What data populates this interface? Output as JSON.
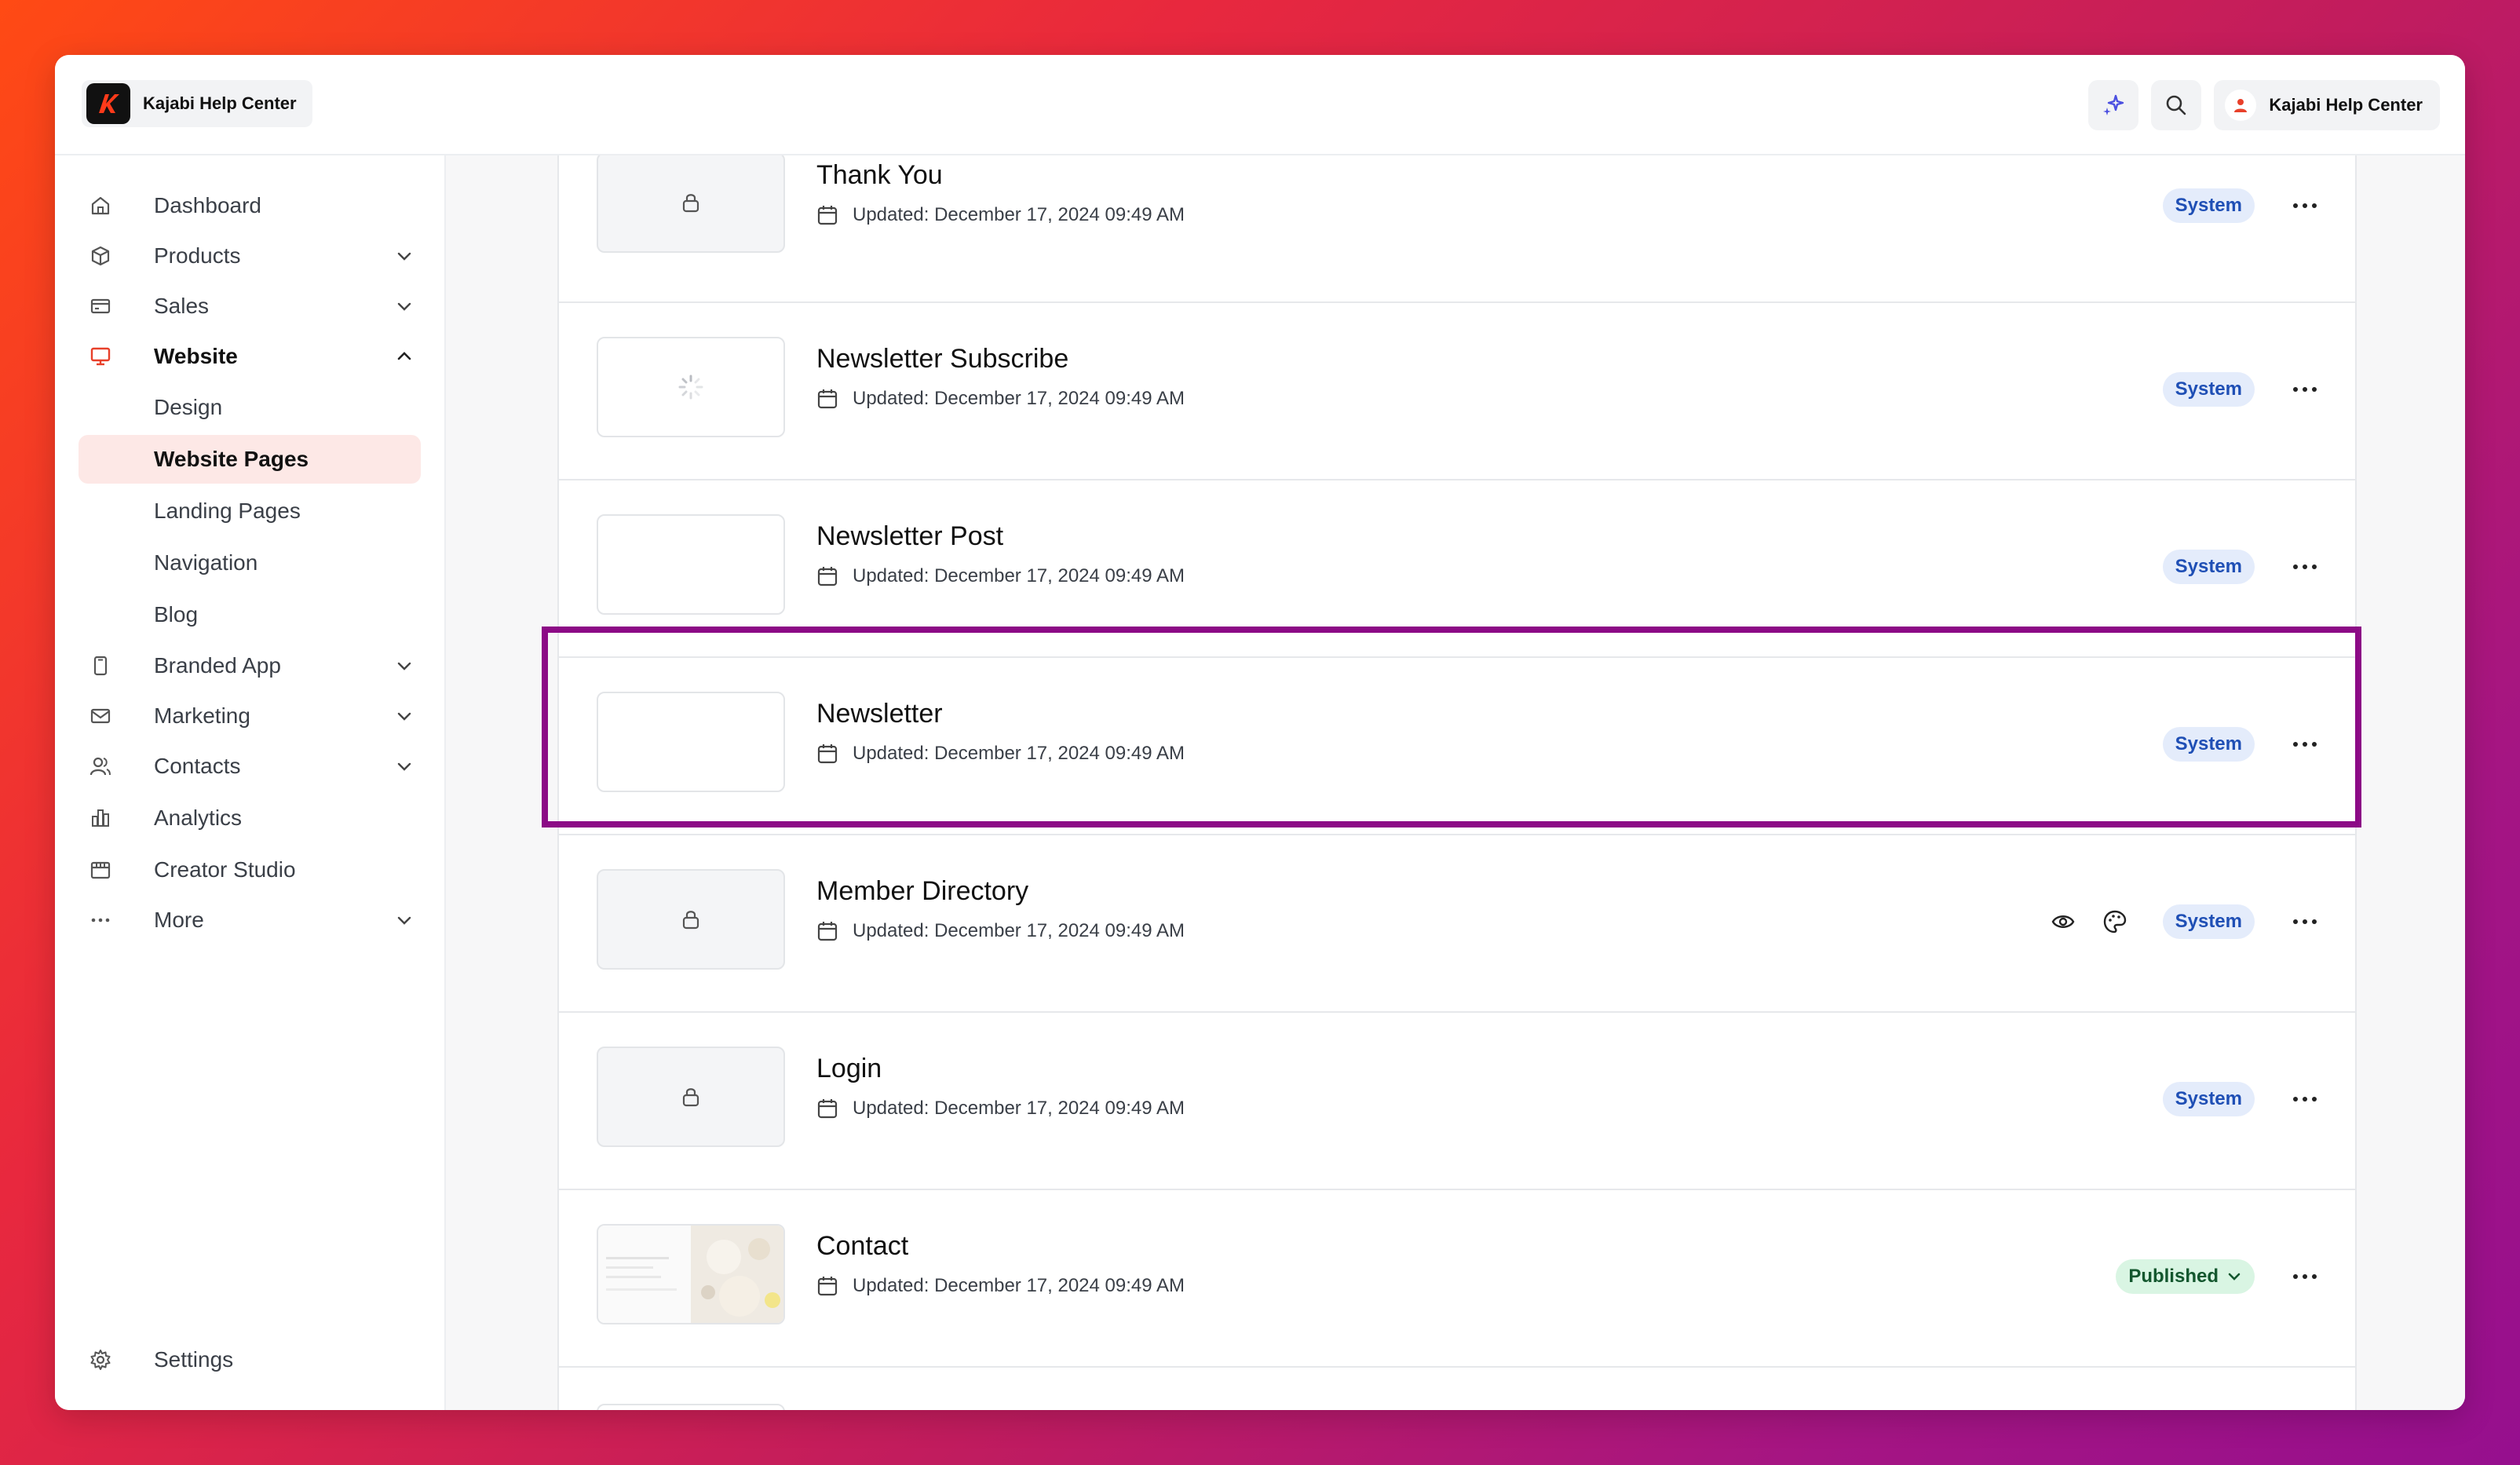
{
  "header": {
    "brand_name": "Kajabi Help Center",
    "account_name": "Kajabi Help Center",
    "icons": [
      "sparkle-icon",
      "search-icon",
      "user-icon"
    ]
  },
  "sidebar": {
    "items": [
      {
        "label": "Dashboard",
        "icon": "home-icon"
      },
      {
        "label": "Products",
        "icon": "box-icon",
        "expandable": true
      },
      {
        "label": "Sales",
        "icon": "credit-card-icon",
        "expandable": true
      },
      {
        "label": "Website",
        "icon": "monitor-icon",
        "expanded": true,
        "active": true
      },
      {
        "label": "Branded App",
        "icon": "phone-icon",
        "expandable": true
      },
      {
        "label": "Marketing",
        "icon": "mail-icon",
        "expandable": true
      },
      {
        "label": "Contacts",
        "icon": "users-icon",
        "expandable": true
      },
      {
        "label": "Analytics",
        "icon": "bar-chart-icon"
      },
      {
        "label": "Creator Studio",
        "icon": "calendar-icon"
      },
      {
        "label": "More",
        "icon": "dots-icon",
        "expandable": true
      }
    ],
    "website_sub": [
      "Design",
      "Website Pages",
      "Landing Pages",
      "Navigation",
      "Blog"
    ],
    "selected_sub": "Website Pages",
    "settings_label": "Settings",
    "accent_color": "#e8402a"
  },
  "pages": [
    {
      "title": "Thank You",
      "updated": "Updated: December 17, 2024 09:49 AM",
      "status": "System",
      "thumb": "lock"
    },
    {
      "title": "Newsletter Subscribe",
      "updated": "Updated: December 17, 2024 09:49 AM",
      "status": "System",
      "thumb": "loading"
    },
    {
      "title": "Newsletter Post",
      "updated": "Updated: December 17, 2024 09:49 AM",
      "status": "System",
      "thumb": "blank"
    },
    {
      "title": "Newsletter",
      "updated": "Updated: December 17, 2024 09:49 AM",
      "status": "System",
      "thumb": "blank",
      "highlighted": true
    },
    {
      "title": "Member Directory",
      "updated": "Updated: December 17, 2024 09:49 AM",
      "status": "System",
      "thumb": "lock",
      "extra_icons": [
        "eye-icon",
        "palette-icon"
      ]
    },
    {
      "title": "Login",
      "updated": "Updated: December 17, 2024 09:49 AM",
      "status": "System",
      "thumb": "lock"
    },
    {
      "title": "Contact",
      "updated": "Updated: December 17, 2024 09:49 AM",
      "status": "Published",
      "thumb": "preview"
    }
  ],
  "colors": {
    "system_badge_bg": "#e4ecfb",
    "system_badge_text": "#1f4fb5",
    "published_badge_bg": "#d9f5e3",
    "published_badge_text": "#13572e",
    "highlight_border": "#8c0a86"
  }
}
